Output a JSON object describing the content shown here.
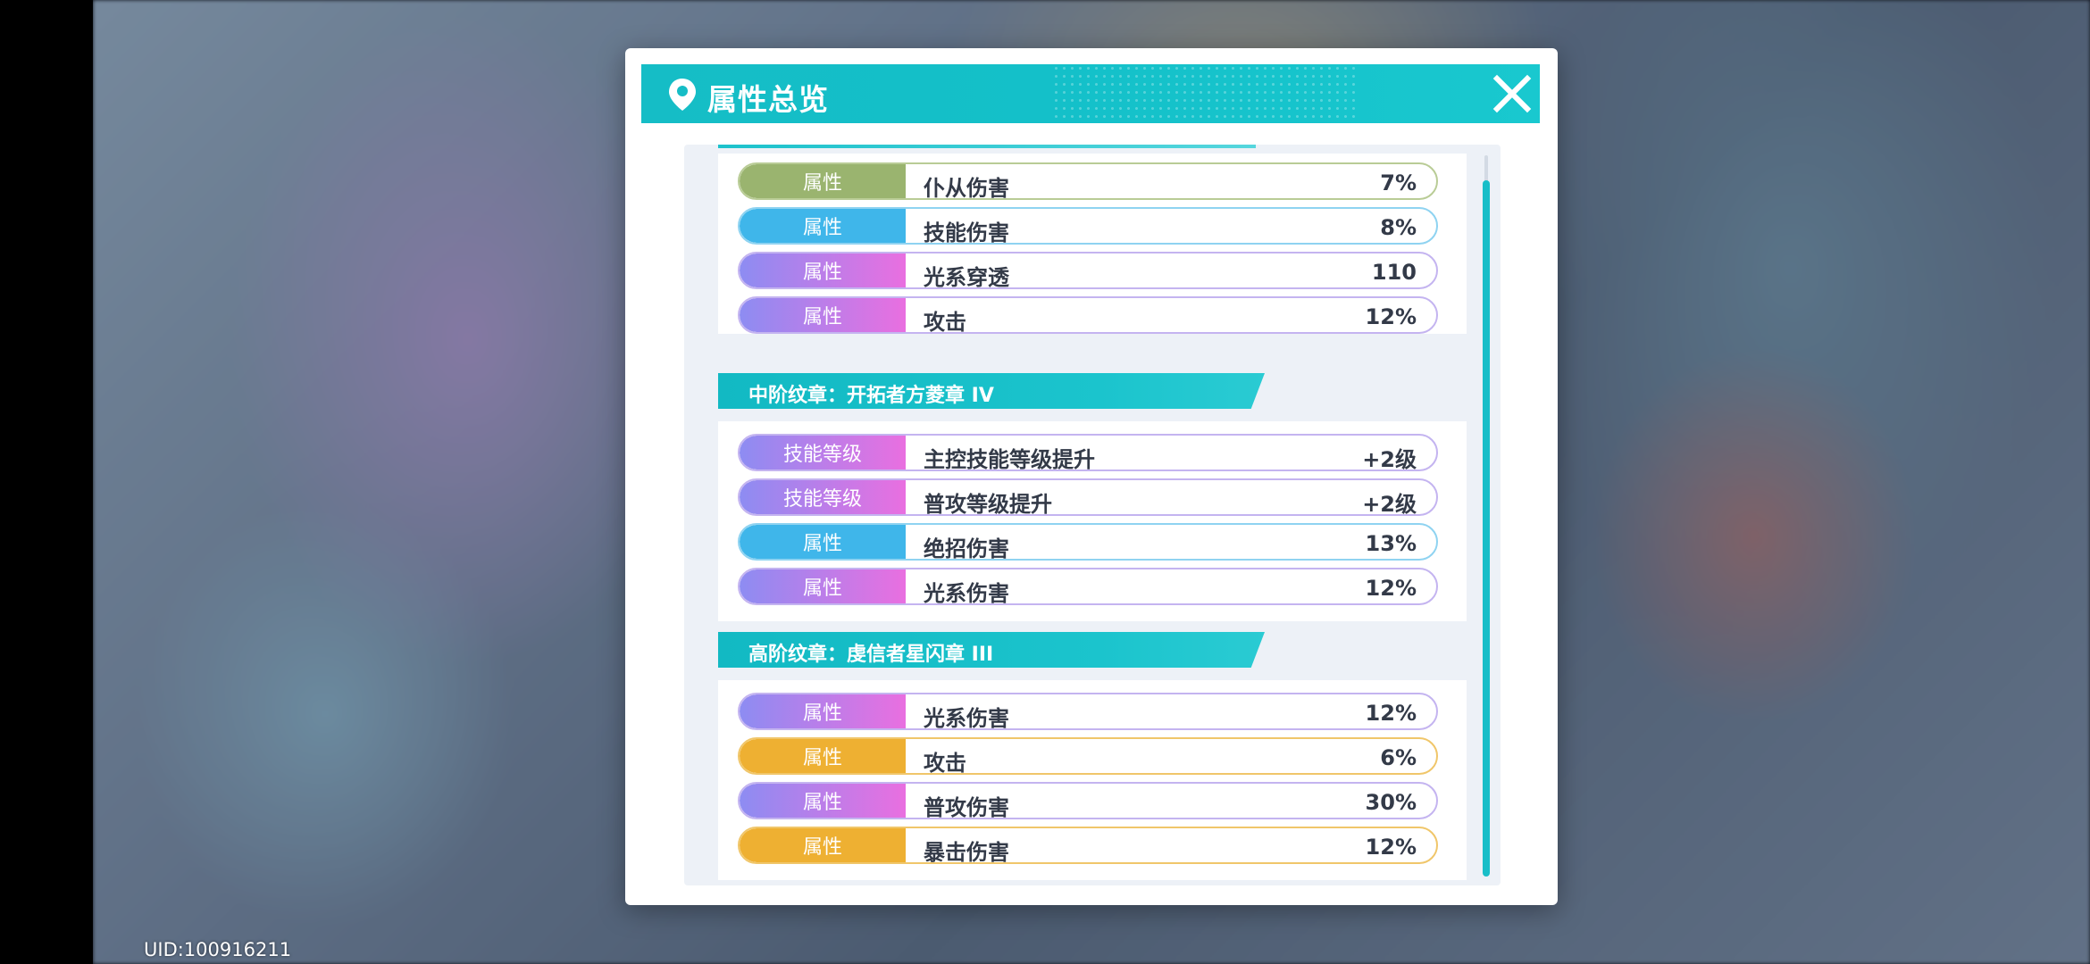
{
  "uid": "UID:100916211",
  "dialog": {
    "title": "属性总览",
    "close_icon": "close-icon",
    "pin_icon": "location-pin-icon"
  },
  "colors": {
    "teal": "#15bdc6",
    "olive": "#9ab46f",
    "sky": "#3fb6ea",
    "gradient_purple": "#8d8cf2",
    "gradient_pink": "#e96fe0",
    "orange": "#eeb032"
  },
  "top_rows": [
    {
      "tag": "属性",
      "name": "仆从伤害",
      "value": "7%",
      "style": "olive"
    },
    {
      "tag": "属性",
      "name": "技能伤害",
      "value": "8%",
      "style": "sky"
    },
    {
      "tag": "属性",
      "name": "光系穿透",
      "value": "110",
      "style": "gradient"
    },
    {
      "tag": "属性",
      "name": "攻击",
      "value": "12%",
      "style": "gradient"
    }
  ],
  "sections": [
    {
      "title": "中阶纹章：开拓者方菱章 IV",
      "rows": [
        {
          "tag": "技能等级",
          "name": "主控技能等级提升",
          "value": "+2级",
          "style": "gradient"
        },
        {
          "tag": "技能等级",
          "name": "普攻等级提升",
          "value": "+2级",
          "style": "gradient"
        },
        {
          "tag": "属性",
          "name": "绝招伤害",
          "value": "13%",
          "style": "sky"
        },
        {
          "tag": "属性",
          "name": "光系伤害",
          "value": "12%",
          "style": "gradient"
        }
      ]
    },
    {
      "title": "高阶纹章：虔信者星闪章 III",
      "rows": [
        {
          "tag": "属性",
          "name": "光系伤害",
          "value": "12%",
          "style": "gradient"
        },
        {
          "tag": "属性",
          "name": "攻击",
          "value": "6%",
          "style": "orange"
        },
        {
          "tag": "属性",
          "name": "普攻伤害",
          "value": "30%",
          "style": "gradient"
        },
        {
          "tag": "属性",
          "name": "暴击伤害",
          "value": "12%",
          "style": "orange"
        }
      ]
    }
  ]
}
